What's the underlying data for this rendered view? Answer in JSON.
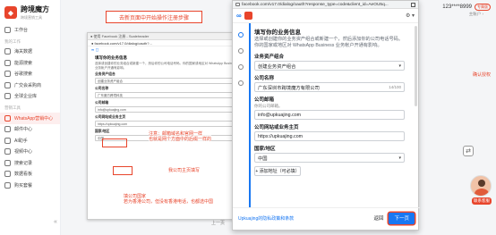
{
  "app": {
    "brand_title": "跨境魔方",
    "brand_sub": "跨境营销工具",
    "sections": [
      "我的工作",
      "营销工具"
    ],
    "nav_top": [
      "工作台"
    ],
    "nav_mid": [
      "海关数据",
      "能源搜索",
      "谷歌搜索",
      "广交会采购商",
      "全球企业库"
    ],
    "nav_bottom": [
      "WhatsApp营销中心",
      "邮件中心",
      "AI助手",
      "视频中心",
      "搜索记录",
      "数据看板",
      "购买套餐"
    ],
    "collapse_icon": "«",
    "top_annotation": "去新页面中开始操作注册步骤",
    "user_phone": "123****8999",
    "user_badge": "专属版",
    "user_role": "主账户 ›",
    "side_hint": "确认授权",
    "pagination": "上一页",
    "support_label": "联系客服",
    "accent": "#e8452c"
  },
  "inset": {
    "titlebar": "● 使用 Facebook 注册 - Scaleheader",
    "url": "● facebook.com/v17.0/dialog/oauth?...",
    "logos": "∞ ◻",
    "title": "填写你的业务信息",
    "text": "选择或创建你的业务组合或新建一个，然后你的公司电话号码。你的国家或地区对 WhatsApp Business 业务帐户开通有影响。",
    "field1_label": "业务资产组合",
    "field1_value": "创建业务资产组合",
    "field2_label": "公司名称",
    "field2_value": "广东魔方跨境科技",
    "field3_label": "公司邮箱",
    "field3_value": "info@upkuajing.com",
    "field4_label": "公司网站或业务主页",
    "field4_value": "https://upkuajing.com",
    "field5_label": "国家/地区",
    "field5_value": "中国",
    "note1": "注意：邮箱域名和官网一样\n也就是网个方面中的后缀一样的",
    "note2": "我公司主页填写",
    "note3": "填公司国家\n若为香港公司，但没有香港电话，也都选中国"
  },
  "fb": {
    "url": "facebook.com/v17.0/dialog/oauth?response_type=code&client_id=AeOU5q...",
    "gear": "⚙ ▾",
    "section_title": "填写你的业务信息",
    "section_desc": "选择或创建你的业务资产组合或新建一个，然后添加你的公司电话号码。你的国家或地区对 WhatsApp Business 业务帐户开通有影响。",
    "portfolio_label": "业务资产组合",
    "portfolio_value": "创建业务资产组合",
    "company_name_label": "公司名称",
    "company_name_value": "广东深圳市跨境魔方有限公司",
    "company_name_counter": "14/100",
    "email_label": "公司邮箱",
    "email_help": "你的公司邮箱。",
    "email_value": "info@upkuajing.com",
    "website_label": "公司网站或业务主页",
    "website_value": "https://upkuajing.com",
    "country_label": "国家/地区",
    "country_value": "中国",
    "add_website": "+ 添加地址（可必填）",
    "policy_link": "Upkuajing的隐私政策和条款",
    "back_label": "返回",
    "next_label": "下一页",
    "caret": "▾",
    "fb_blue": "#1877f2"
  }
}
